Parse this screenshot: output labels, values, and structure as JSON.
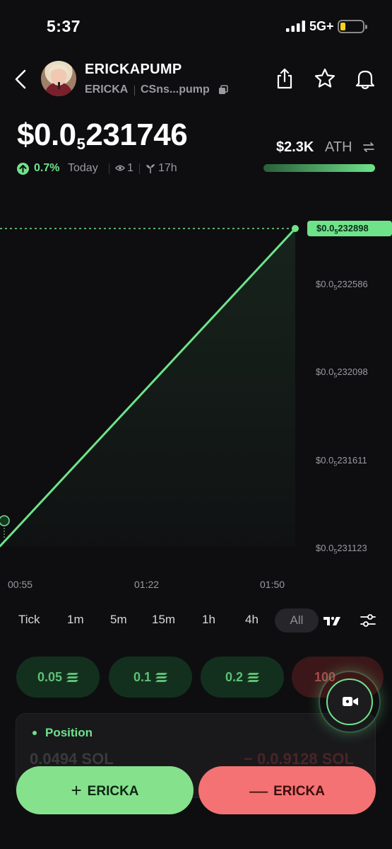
{
  "status_bar": {
    "time": "5:37",
    "network": "5G+"
  },
  "token": {
    "name": "ERICKAPUMP",
    "ticker": "ERICKA",
    "address": "CSns...pump",
    "price_prefix": "$0.0",
    "price_subscript": "5",
    "price_digits": "231746",
    "change": "0.7%",
    "period": "Today",
    "viewers": "1",
    "age": "17h",
    "ath_value": "$2.3K",
    "ath_label": "ATH",
    "ath_progress": 1.0
  },
  "chart_data": {
    "type": "line",
    "x": [
      "00:55",
      "01:50"
    ],
    "y": [
      2.31e-05,
      2.32898e-05
    ],
    "xticks": [
      "00:55",
      "01:22",
      "01:50"
    ],
    "yticks": [
      {
        "prefix": "$0.0",
        "sub": "5",
        "digits": "232586",
        "value": 2.32586e-06
      },
      {
        "prefix": "$0.0",
        "sub": "5",
        "digits": "232098",
        "value": 2.32098e-06
      },
      {
        "prefix": "$0.0",
        "sub": "5",
        "digits": "231611",
        "value": 2.31611e-06
      },
      {
        "prefix": "$0.0",
        "sub": "5",
        "digits": "231123",
        "value": 2.31123e-06
      }
    ],
    "last_price": {
      "prefix": "$0.0",
      "sub": "5",
      "digits": "232898",
      "value": 2.32898e-06
    },
    "color": "#6ee38a"
  },
  "timeframes": [
    "Tick",
    "1m",
    "5m",
    "15m",
    "1h",
    "4h",
    "All"
  ],
  "selected_timeframe": "All",
  "amounts": [
    "0.05",
    "0.1",
    "0.2",
    "100"
  ],
  "position": {
    "title": "Position",
    "amount": "0.0494 SOL",
    "pnl": "− 0.0.9128 SOL"
  },
  "actions": {
    "buy_label": "ERICKA",
    "sell_label": "ERICKA"
  },
  "colors": {
    "accent_green": "#6ee38a",
    "sell_red": "#f47273",
    "background": "#0e0e10"
  }
}
